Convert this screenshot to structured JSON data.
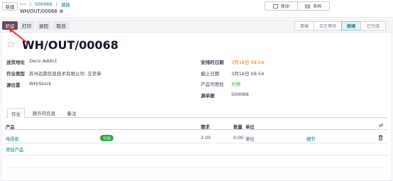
{
  "topbar": {
    "new_label": "新建",
    "crumb_dots": "···",
    "crumb_sep": "/",
    "crumb_ref": "S00066",
    "crumb_sep2": "/",
    "crumb_section": "调拨",
    "record_title": "WH/OUT/00068",
    "view_mobile_label": "移动",
    "view_barcode_label": "条码"
  },
  "actions": {
    "validate": "验证",
    "print": "打印",
    "return": "退回",
    "cancel": "取消"
  },
  "status": {
    "stages": [
      "草稿",
      "正在等待",
      "就绪",
      "已完成"
    ],
    "current": "就绪"
  },
  "form": {
    "title": "WH/OUT/00068",
    "delivery_address_label": "送货地址",
    "delivery_address_value": "Deco Addict",
    "operation_type_label": "作业类型",
    "operation_type_value": "苏州远鼎信息技术有限公司: 交货单",
    "source_location_label": "源位置",
    "source_location_value": "WH/Stock",
    "scheduled_date_label": "安排的日期",
    "scheduled_date_value": "3月18日 09:54",
    "deadline_label": "截止日期",
    "deadline_value": "3月18日 09:54",
    "availability_label": "产品可用性",
    "availability_value": "可用",
    "source_doc_label": "源单据",
    "source_doc_value": "S00066"
  },
  "tabs": [
    "作业",
    "额外的信息",
    "备注"
  ],
  "table": {
    "headers": {
      "product": "产品",
      "demand": "需求",
      "quantity": "数量",
      "unit": "单位"
    },
    "rows": [
      {
        "product": "电视机",
        "badge": "可用",
        "demand": "2.00",
        "quantity": "0.00",
        "unit": "单位",
        "detail": "细节"
      }
    ],
    "add_line": "添加产品"
  },
  "colors": {
    "primary": "#71405f",
    "link": "#017e84",
    "available": "#28a745",
    "scheduled_date": "#d97706",
    "annotation_arrow": "#e03131"
  },
  "icons": {
    "favorite": "star-icon",
    "settings": "gear-icon",
    "delete": "trash-icon",
    "columns": "adjust-columns-icon"
  }
}
